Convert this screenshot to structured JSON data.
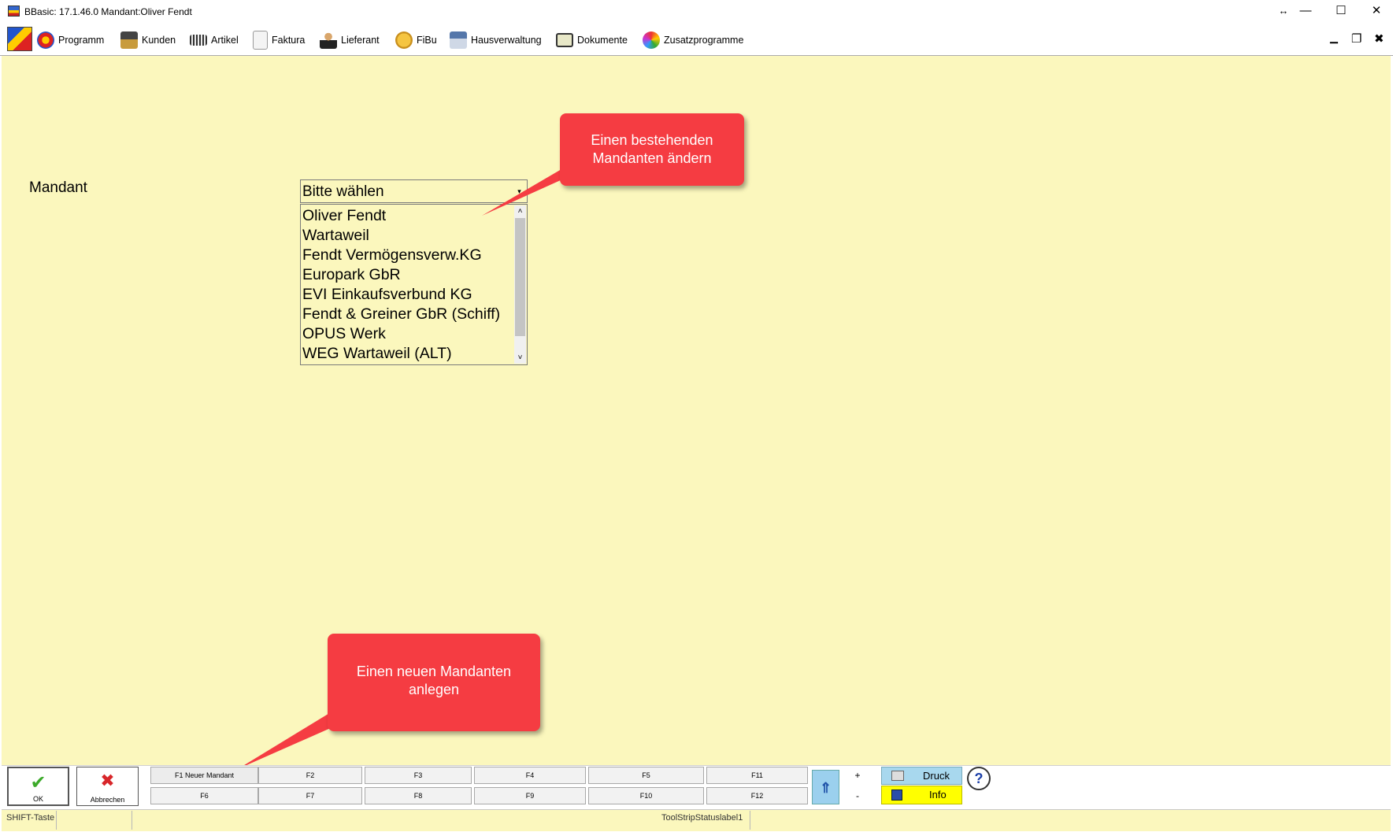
{
  "window": {
    "title": "BBasic: 17.1.46.0 Mandant:Oliver Fendt",
    "resize_glyph": "↔",
    "minimize_glyph": "—",
    "maximize_glyph": "☐",
    "close_glyph": "✕"
  },
  "menu": {
    "items": [
      {
        "label": "Programm",
        "icon": "globe-icon"
      },
      {
        "label": "Kunden",
        "icon": "people-icon"
      },
      {
        "label": "Artikel",
        "icon": "barcode-icon"
      },
      {
        "label": "Faktura",
        "icon": "document-icon"
      },
      {
        "label": "Lieferant",
        "icon": "person-icon"
      },
      {
        "label": "FiBu",
        "icon": "coins-icon"
      },
      {
        "label": "Hausverwaltung",
        "icon": "house-icon"
      },
      {
        "label": "Dokumente",
        "icon": "monitor-icon"
      },
      {
        "label": "Zusatzprogramme",
        "icon": "puzzle-icon"
      }
    ],
    "mdi_minimize_glyph": "▁",
    "mdi_restore_glyph": "❐",
    "mdi_close_glyph": "✖"
  },
  "form": {
    "mandant_label": "Mandant",
    "combo_value": "Bitte wählen",
    "combo_arrow": "▾",
    "scroll_up": "˄",
    "scroll_down": "˅",
    "options": [
      "Oliver Fendt",
      "Wartaweil",
      "Fendt Vermögensverw.KG",
      "Europark GbR",
      "EVI Einkaufsverbund KG",
      "Fendt & Greiner GbR (Schiff)",
      "OPUS Werk",
      "WEG Wartaweil (ALT)"
    ]
  },
  "callouts": {
    "edit_line1": "Einen bestehenden",
    "edit_line2": "Mandanten ändern",
    "new_line1": "Einen neuen Mandanten",
    "new_line2": "anlegen"
  },
  "toolbar": {
    "ok_label": "OK",
    "ok_glyph": "✔",
    "cancel_label": "Abbrechen",
    "cancel_glyph": "✖",
    "fkeys_top": [
      "F1 Neuer Mandant",
      "F2",
      "F3",
      "F4",
      "F5",
      "F11"
    ],
    "fkeys_bottom": [
      "F6",
      "F7",
      "F8",
      "F9",
      "F10",
      "F12"
    ],
    "scrolltop_glyph": "⇑",
    "plus_label": "+",
    "minus_label": "-",
    "druck_label": "Druck",
    "info_label": "Info",
    "help_glyph": "?"
  },
  "status": {
    "left": "SHIFT-Taste",
    "center": "ToolStripStatuslabel1"
  }
}
